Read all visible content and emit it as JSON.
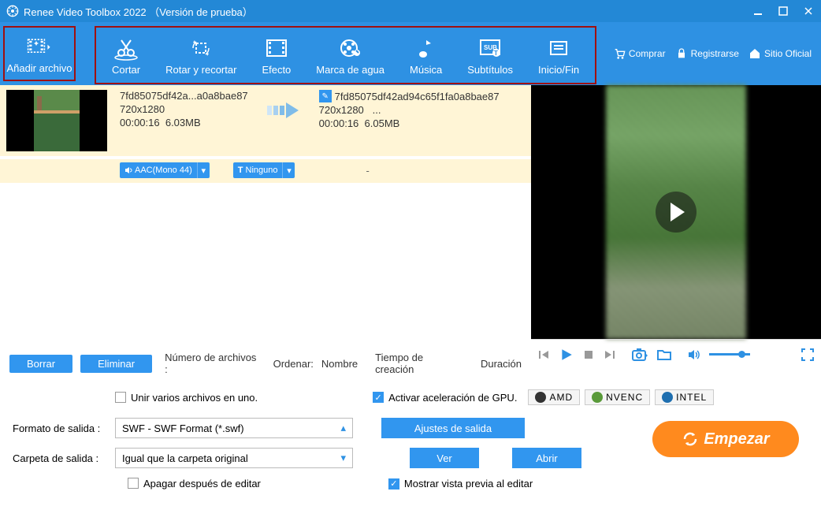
{
  "titlebar": {
    "title": "Renee Video Toolbox 2022 （Versión de prueba）"
  },
  "toolbar": {
    "add": "Añadir archivo",
    "cut": "Cortar",
    "rotate": "Rotar y recortar",
    "effect": "Efecto",
    "watermark": "Marca de agua",
    "music": "Música",
    "subtitles": "Subtítulos",
    "startend": "Inicio/Fin",
    "buy": "Comprar",
    "register": "Registrarse",
    "site": "Sitio Oficial"
  },
  "file": {
    "src_name": "7fd85075df42a...a0a8bae87",
    "src_res": "720x1280",
    "src_dur": "00:00:16",
    "src_size": "6.03MB",
    "out_name": "7fd85075df42ad94c65f1fa0a8bae87",
    "out_res": "720x1280",
    "out_dots": "...",
    "out_dur": "00:00:16",
    "out_size": "6.05MB",
    "audio_tag": "AAC(Mono 44)",
    "sub_tag": "Ninguno",
    "dash": "-"
  },
  "list_controls": {
    "delete": "Borrar",
    "remove": "Eliminar",
    "count_label": "Número de archivos :",
    "order_label": "Ordenar:",
    "order_name": "Nombre",
    "order_time": "Tiempo de creación",
    "order_dur": "Duración"
  },
  "options": {
    "merge": "Unir varios archivos en uno.",
    "gpu": "Activar aceleración de GPU.",
    "amd": "AMD",
    "nvenc": "NVENC",
    "intel": "INTEL"
  },
  "form": {
    "format_label": "Formato de salida :",
    "format_value": "SWF - SWF Format (*.swf)",
    "folder_label": "Carpeta de salida :",
    "folder_value": "Igual que la carpeta original",
    "settings_btn": "Ajustes de salida",
    "view_btn": "Ver",
    "open_btn": "Abrir",
    "shutdown": "Apagar después de editar",
    "preview_edit": "Mostrar vista previa al editar",
    "start": "Empezar"
  }
}
